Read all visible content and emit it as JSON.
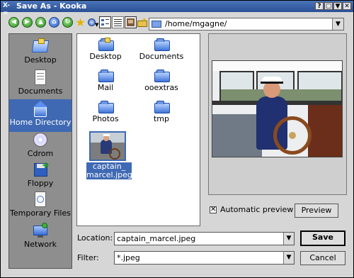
{
  "window": {
    "title": "Save As - Kooka",
    "menu_glyph": "X-=",
    "buttons": [
      "?",
      "▢",
      "▼",
      "✕"
    ]
  },
  "toolbar": {
    "buttons": [
      "back-icon",
      "forward-icon",
      "up-icon",
      "home-icon",
      "reload-icon",
      "bookmarks-icon",
      "settings-icon",
      "icon-view-icon",
      "detail-view-icon",
      "preview-icon",
      "new-folder-icon"
    ],
    "path": "/home/mgagne/"
  },
  "sidebar": {
    "items": [
      {
        "label": "Desktop",
        "icon": "desktop-icon",
        "selected": false
      },
      {
        "label": "Documents",
        "icon": "documents-icon",
        "selected": false
      },
      {
        "label": "Home Directory",
        "icon": "home-icon",
        "selected": true
      },
      {
        "label": "Cdrom",
        "icon": "cdrom-icon",
        "selected": false
      },
      {
        "label": "Floppy",
        "icon": "floppy-icon",
        "selected": false
      },
      {
        "label": "Temporary Files",
        "icon": "temp-files-icon",
        "selected": false
      },
      {
        "label": "Network",
        "icon": "network-icon",
        "selected": false
      }
    ]
  },
  "files": [
    {
      "label": "Desktop",
      "icon": "desktop-folder-icon"
    },
    {
      "label": "Documents",
      "icon": "folder-icon"
    },
    {
      "label": "Mail",
      "icon": "folder-icon"
    },
    {
      "label": "ooextras",
      "icon": "folder-icon"
    },
    {
      "label": "Photos",
      "icon": "folder-icon"
    },
    {
      "label": "tmp",
      "icon": "folder-icon"
    }
  ],
  "selected_file": {
    "label_line1": "captain_",
    "label_line2": "marcel.jpeg"
  },
  "preview": {
    "auto_label": "Automatic preview",
    "auto_checked": "✕",
    "button": "Preview"
  },
  "location": {
    "label": "Location:",
    "value": "captain_marcel.jpeg"
  },
  "filter": {
    "label": "Filter:",
    "value": "*.jpeg"
  },
  "actions": {
    "save": "Save",
    "cancel": "Cancel"
  },
  "colors": {
    "selection": "#3f69b3",
    "title": "#2a4f94"
  }
}
